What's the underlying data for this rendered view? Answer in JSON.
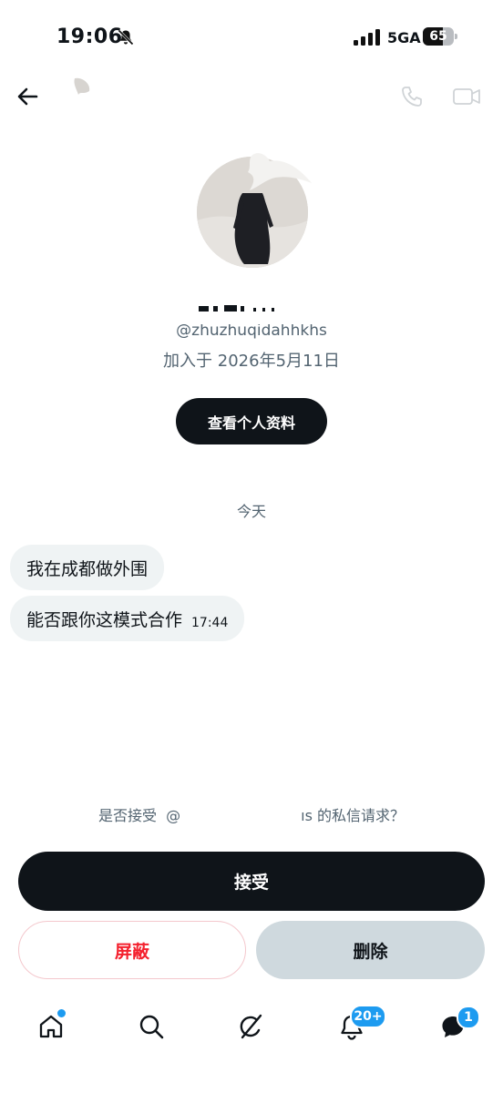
{
  "status_bar": {
    "time": "19:06",
    "network": "5GA",
    "battery": "65",
    "battery_level": 0.65
  },
  "profile": {
    "name_fragment": "Зре​    · · ·",
    "handle": "@zhuzhuqidahhkhs",
    "joined": "加入于 2026年5月11日",
    "view_profile_label": "查看个人资料"
  },
  "conversation": {
    "day_label": "今天",
    "messages": [
      {
        "text": "我在成都做外围",
        "time": ""
      },
      {
        "text": "能否跟你这模式合作",
        "time": "17:44"
      }
    ]
  },
  "request": {
    "prompt_prefix": "是否接受  @",
    "prompt_suffix": "ıs 的私信请求？",
    "accept_label": "接受",
    "block_label": "屏蔽",
    "delete_label": "删除"
  },
  "nav": {
    "notifications_badge": "20+",
    "messages_badge": "1"
  },
  "colors": {
    "accent": "#1d9bf0",
    "danger": "#f4212e",
    "dark": "#0f1419",
    "muted": "#536471",
    "bubble": "#eff3f4"
  },
  "icons": [
    "bell-off-icon",
    "signal-icon",
    "battery-icon",
    "back-arrow-icon",
    "phone-icon",
    "video-icon",
    "home-icon",
    "search-icon",
    "grok-icon",
    "notifications-bell-icon",
    "messages-icon"
  ]
}
